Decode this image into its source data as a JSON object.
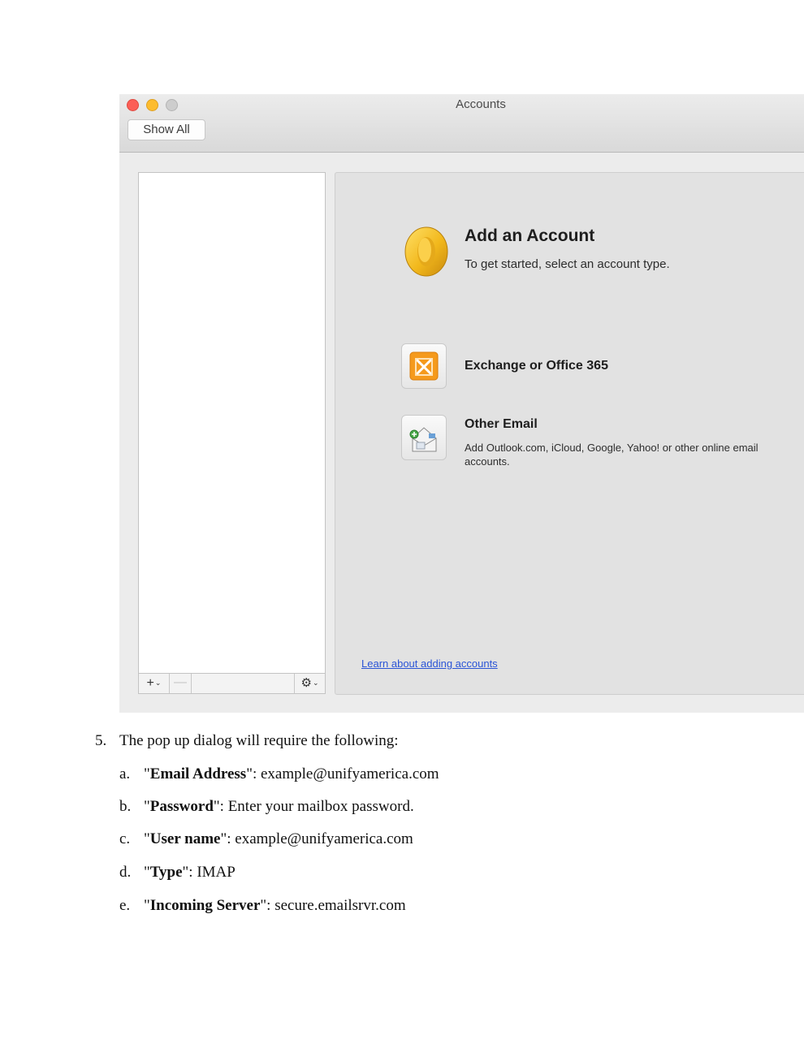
{
  "window": {
    "title": "Accounts",
    "show_all_label": "Show All"
  },
  "list_toolbar": {
    "add_symbol": "+",
    "chevron": "⌄",
    "remove_symbol": "—",
    "gear_symbol": "⚙"
  },
  "content": {
    "add_title": "Add an Account",
    "add_subtitle": "To get started, select an account type.",
    "options": [
      {
        "label": "Exchange or Office 365",
        "icon": "exchange-icon"
      },
      {
        "label": "Other Email",
        "description": "Add Outlook.com, iCloud, Google, Yahoo! or other online email accounts.",
        "icon": "other-email-icon"
      }
    ],
    "learn_link": "Learn about adding accounts"
  },
  "doc": {
    "step_number": "5.",
    "step_text": "The pop up dialog will require the following:",
    "items": [
      {
        "letter": "a.",
        "q1": "\"",
        "field": "Email Address",
        "q2": "\": ",
        "value": "example@unifyamerica.com"
      },
      {
        "letter": "b.",
        "q1": "\"",
        "field": "Password",
        "q2": "\": ",
        "value": "Enter your mailbox password."
      },
      {
        "letter": "c.",
        "q1": "\"",
        "field": "User name",
        "q2": "\": ",
        "value": "example@unifyamerica.com"
      },
      {
        "letter": "d.",
        "q1": "\"",
        "field": "Type",
        "q2": "\": ",
        "value": "IMAP"
      },
      {
        "letter": "e.",
        "q1": "\"",
        "field": "Incoming Server",
        "q2": "\": ",
        "value": "secure.emailsrvr.com"
      }
    ]
  },
  "colors": {
    "close": "#fc5f57",
    "minimize": "#fdbc2e",
    "zoom": "#cdcdcd",
    "link": "#2a54d6",
    "exchange_orange": "#f59a1c",
    "outlook_gold": "#f2b81c"
  }
}
